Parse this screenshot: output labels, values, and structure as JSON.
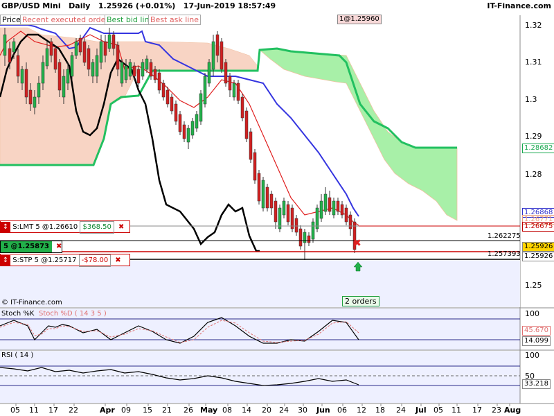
{
  "header": {
    "instrument": "GBP/USD Mini",
    "timeframe": "Daily",
    "price": "1.25926",
    "change": "(+0.01%)",
    "datetime": "17-Jun-2019 18:57:49",
    "brand": "IT-Finance.com"
  },
  "legend": {
    "price": "Price",
    "recent": "Recent executed orders",
    "bid": "Best bid line",
    "ask": "Best ask line"
  },
  "top_tag": "1@1.25960",
  "orders": {
    "limit": {
      "label": "S:LMT  5 @1.26610",
      "pnl": "$368.50"
    },
    "position": {
      "label": "5 @1.25873"
    },
    "stop": {
      "label": "S:STP  5 @1.25717",
      "pnl": "-$78.00"
    },
    "count_badge": "2 orders"
  },
  "price_axis": {
    "ticks": [
      "1.32",
      "1.31",
      "1.3",
      "1.29",
      "1.28",
      "1.25"
    ],
    "tags": [
      {
        "text": "1.26868",
        "color": "#3333cc"
      },
      {
        "text": "1.26771",
        "color": "#e8a080"
      },
      {
        "text": "1.26675",
        "color": "#c00000"
      },
      {
        "text": "1.25926",
        "color": "#000000"
      },
      {
        "text": "1.25926",
        "color": "#000000"
      },
      {
        "text": "1.28682",
        "color": "#1aa850"
      }
    ],
    "line_values": [
      "1.262275",
      "1.257393"
    ]
  },
  "watermark": "© IT-Finance.com",
  "stoch": {
    "label_k": "Stoch %K",
    "label_d": "Stoch %D ( 14 3 5 )",
    "ticks": [
      "100",
      "0"
    ],
    "tags": [
      "45.670",
      "14.099"
    ]
  },
  "rsi": {
    "label": "RSI ( 14 )",
    "ticks": [
      "100",
      "50",
      "0"
    ],
    "tag": "33.218"
  },
  "x_axis": [
    "05",
    "11",
    "17",
    "22",
    "Apr",
    "09",
    "15",
    "21",
    "26",
    "May",
    "08",
    "14",
    "20",
    "24",
    "30",
    "Jun",
    "06",
    "12",
    "18",
    "24",
    "Jul",
    "05",
    "11",
    "17",
    "23",
    "Aug"
  ],
  "chart_data": {
    "type": "line",
    "title": "GBP/USD Mini Daily",
    "x": [
      "05",
      "11",
      "17",
      "22",
      "Apr",
      "09",
      "15",
      "21",
      "26",
      "May",
      "08",
      "14",
      "20",
      "24",
      "30",
      "Jun",
      "06",
      "12",
      "18"
    ],
    "ylim": [
      1.245,
      1.325
    ],
    "series": [
      {
        "name": "Best bid line",
        "values": [
          1.318,
          1.317,
          1.318,
          1.319,
          1.317,
          1.312,
          1.316,
          1.315,
          1.314,
          1.312,
          1.311,
          1.308,
          1.292,
          1.288,
          1.28,
          1.274,
          1.271,
          1.269,
          1.268
        ]
      },
      {
        "name": "Best ask line",
        "values": [
          1.304,
          1.295,
          1.285,
          1.285,
          1.3,
          1.3,
          1.307,
          1.307,
          1.307,
          1.309,
          1.309,
          1.309,
          1.318,
          1.319,
          1.319,
          1.308,
          1.293,
          1.287,
          1.287
        ]
      }
    ],
    "stoch_k_last": 14.099,
    "stoch_d_last": 45.67,
    "rsi_last": 33.218,
    "last_price": 1.25926
  },
  "colors": {
    "bull": "#22b04a",
    "bear": "#d02020",
    "bid": "#3535e0",
    "kijun": "#e02020",
    "chikou": "#000000",
    "cloud_bear": "#f8d4c4",
    "cloud_bull": "#a8f0a8",
    "ask_green": "#22c060"
  }
}
